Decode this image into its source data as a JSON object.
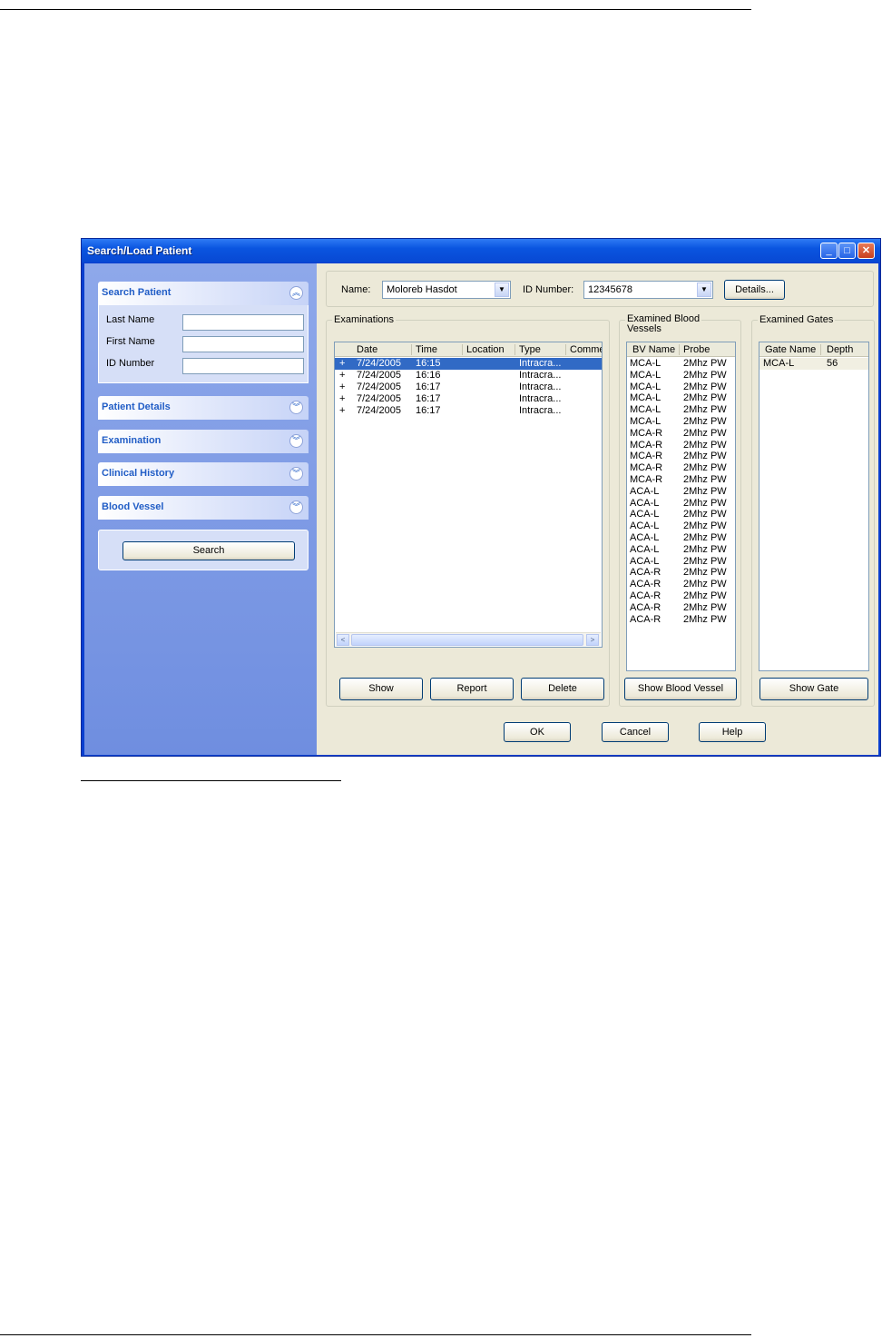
{
  "window": {
    "title": "Search/Load Patient",
    "min_glyph": "_",
    "max_glyph": "□",
    "close_glyph": "✕"
  },
  "task_panel": {
    "search_patient": {
      "title": "Search Patient",
      "fields": [
        {
          "label": "Last Name",
          "value": ""
        },
        {
          "label": "First Name",
          "value": ""
        },
        {
          "label": "ID Number",
          "value": ""
        }
      ],
      "chevron": "︽"
    },
    "sections": [
      {
        "title": "Patient Details",
        "chevron": "︾"
      },
      {
        "title": "Examination",
        "chevron": "︾"
      },
      {
        "title": "Clinical History",
        "chevron": "︾"
      },
      {
        "title": "Blood Vessel",
        "chevron": "︾"
      }
    ],
    "search_button": "Search"
  },
  "patient_bar": {
    "name_label": "Name:",
    "name_value": "Moloreb Hasdot",
    "id_label": "ID Number:",
    "id_value": "12345678",
    "details_button": "Details...",
    "dropdown_glyph": "▼"
  },
  "examinations": {
    "group_label": "Examinations",
    "columns": [
      "Date",
      "Time",
      "Location",
      "Type",
      "Comme"
    ],
    "rows": [
      {
        "marker": "+",
        "date": "7/24/2005",
        "time": "16:15",
        "location": "",
        "type": "Intracra...",
        "selected": true
      },
      {
        "marker": "+",
        "date": "7/24/2005",
        "time": "16:16",
        "location": "",
        "type": "Intracra...",
        "selected": false
      },
      {
        "marker": "+",
        "date": "7/24/2005",
        "time": "16:17",
        "location": "",
        "type": "Intracra...",
        "selected": false
      },
      {
        "marker": "+",
        "date": "7/24/2005",
        "time": "16:17",
        "location": "",
        "type": "Intracra...",
        "selected": false
      },
      {
        "marker": "+",
        "date": "7/24/2005",
        "time": "16:17",
        "location": "",
        "type": "Intracra...",
        "selected": false
      }
    ],
    "scroll_left": "<",
    "scroll_right": ">",
    "buttons": {
      "show": "Show",
      "report": "Report",
      "delete": "Delete"
    }
  },
  "blood_vessels": {
    "group_label_line1": "Examined Blood",
    "group_label_line2": "Vessels",
    "columns": [
      "BV Name",
      "Probe"
    ],
    "rows": [
      [
        "MCA-L",
        "2Mhz PW"
      ],
      [
        "MCA-L",
        "2Mhz PW"
      ],
      [
        "MCA-L",
        "2Mhz PW"
      ],
      [
        "MCA-L",
        "2Mhz PW"
      ],
      [
        "MCA-L",
        "2Mhz PW"
      ],
      [
        "MCA-L",
        "2Mhz PW"
      ],
      [
        "MCA-R",
        "2Mhz PW"
      ],
      [
        "MCA-R",
        "2Mhz PW"
      ],
      [
        "MCA-R",
        "2Mhz PW"
      ],
      [
        "MCA-R",
        "2Mhz PW"
      ],
      [
        "MCA-R",
        "2Mhz PW"
      ],
      [
        "ACA-L",
        "2Mhz PW"
      ],
      [
        "ACA-L",
        "2Mhz PW"
      ],
      [
        "ACA-L",
        "2Mhz PW"
      ],
      [
        "ACA-L",
        "2Mhz PW"
      ],
      [
        "ACA-L",
        "2Mhz PW"
      ],
      [
        "ACA-L",
        "2Mhz PW"
      ],
      [
        "ACA-L",
        "2Mhz PW"
      ],
      [
        "ACA-R",
        "2Mhz PW"
      ],
      [
        "ACA-R",
        "2Mhz PW"
      ],
      [
        "ACA-R",
        "2Mhz PW"
      ],
      [
        "ACA-R",
        "2Mhz PW"
      ],
      [
        "ACA-R",
        "2Mhz PW"
      ]
    ],
    "button": "Show Blood Vessel"
  },
  "gates": {
    "group_label": "Examined Gates",
    "columns": [
      "Gate Name",
      "Depth"
    ],
    "rows": [
      [
        "MCA-L",
        "56"
      ]
    ],
    "button": "Show Gate"
  },
  "footer": {
    "ok": "OK",
    "cancel": "Cancel",
    "help": "Help"
  },
  "colors": {
    "title_blue": "#0a55e0",
    "selection": "#316ac5",
    "panel_blue": "#7f9be3",
    "face": "#ece9d8"
  }
}
